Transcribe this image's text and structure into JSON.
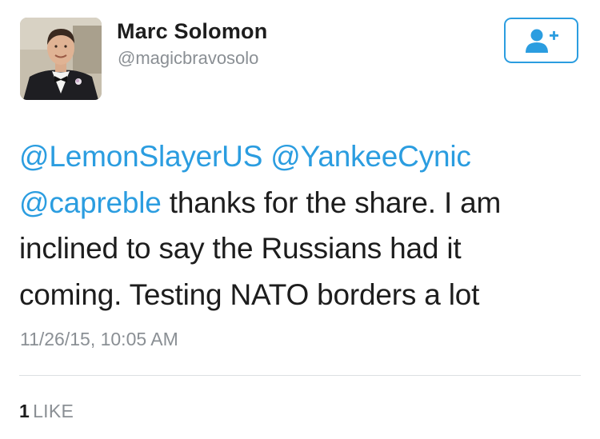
{
  "user": {
    "display_name": "Marc Solomon",
    "handle": "@magicbravosolo",
    "avatar_icon": "user-photo"
  },
  "follow_button": {
    "icon": "add-user-icon",
    "color": "#2b9de0"
  },
  "tweet": {
    "line1": {
      "mention1": "@LemonSlayerUS",
      "mention2": "@YankeeCynic"
    },
    "line2": {
      "mention3": "@capreble",
      "text": " thanks for the share. I am"
    },
    "line3": "inclined to say the Russians had it",
    "line4": "coming. Testing NATO borders a lot",
    "timestamp": "11/26/15, 10:05 AM"
  },
  "stats": {
    "like_count": "1",
    "like_label": "LIKE"
  },
  "colors": {
    "link": "#2b9de0",
    "text": "#1d1d1d",
    "secondary": "#8a8f94",
    "divider": "#dcdfe2"
  }
}
